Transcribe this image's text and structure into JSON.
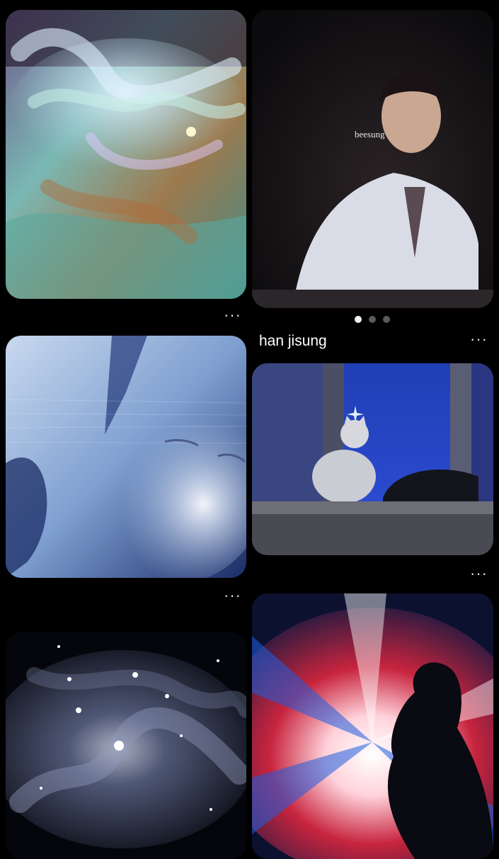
{
  "pins": [
    {
      "id": "pin-hands-painting",
      "icon": "abstract-hands-art"
    },
    {
      "id": "pin-beesung",
      "overlay_text": "beesung",
      "icon": "person-photo"
    },
    {
      "id": "pin-blue-face",
      "icon": "glitch-portrait"
    },
    {
      "id": "pin-cat-window",
      "title": "han jisung",
      "icon": "cat-photo"
    },
    {
      "id": "pin-nebula",
      "icon": "nebula-photo"
    },
    {
      "id": "pin-light-silhouette",
      "icon": "silhouette-photo"
    }
  ],
  "more_menu": {
    "label": "···"
  },
  "carousel": {
    "count": 3,
    "active_index": 0
  }
}
